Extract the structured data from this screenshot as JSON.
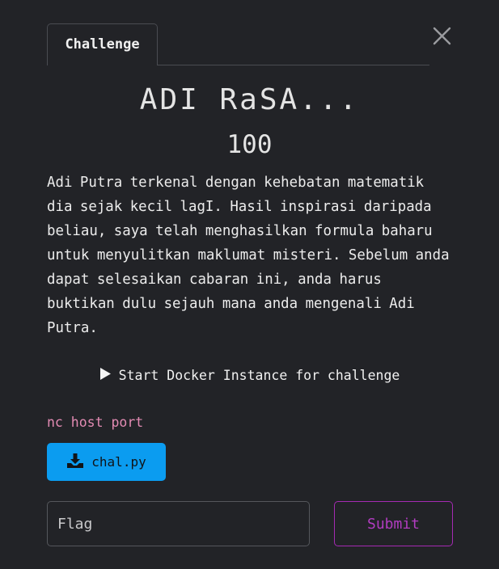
{
  "modal": {
    "tab_label": "Challenge",
    "title": "ADI RaSA...",
    "points": "100",
    "description": "Adi Putra terkenal dengan kehebatan matematik dia sejak kecil lagI. Hasil inspirasi daripada beliau, saya telah menghasilkan formula baharu untuk menyulitkan maklumat misteri. Sebelum anda dapat selesaikan cabaran ini, anda harus buktikan dulu sejauh mana anda mengenali Adi Putra.",
    "docker_button_label": "Start Docker Instance for challenge",
    "connection_info": "nc host port",
    "file_button_label": "chal.py",
    "flag_placeholder": "Flag",
    "submit_label": "Submit"
  },
  "icons": {
    "close": "close-icon",
    "play": "play-icon",
    "download": "download-icon"
  },
  "colors": {
    "background": "#222327",
    "file_button": "#0b9cf0",
    "submit_accent": "#a52ab3",
    "connection_text": "#e38bb3"
  }
}
